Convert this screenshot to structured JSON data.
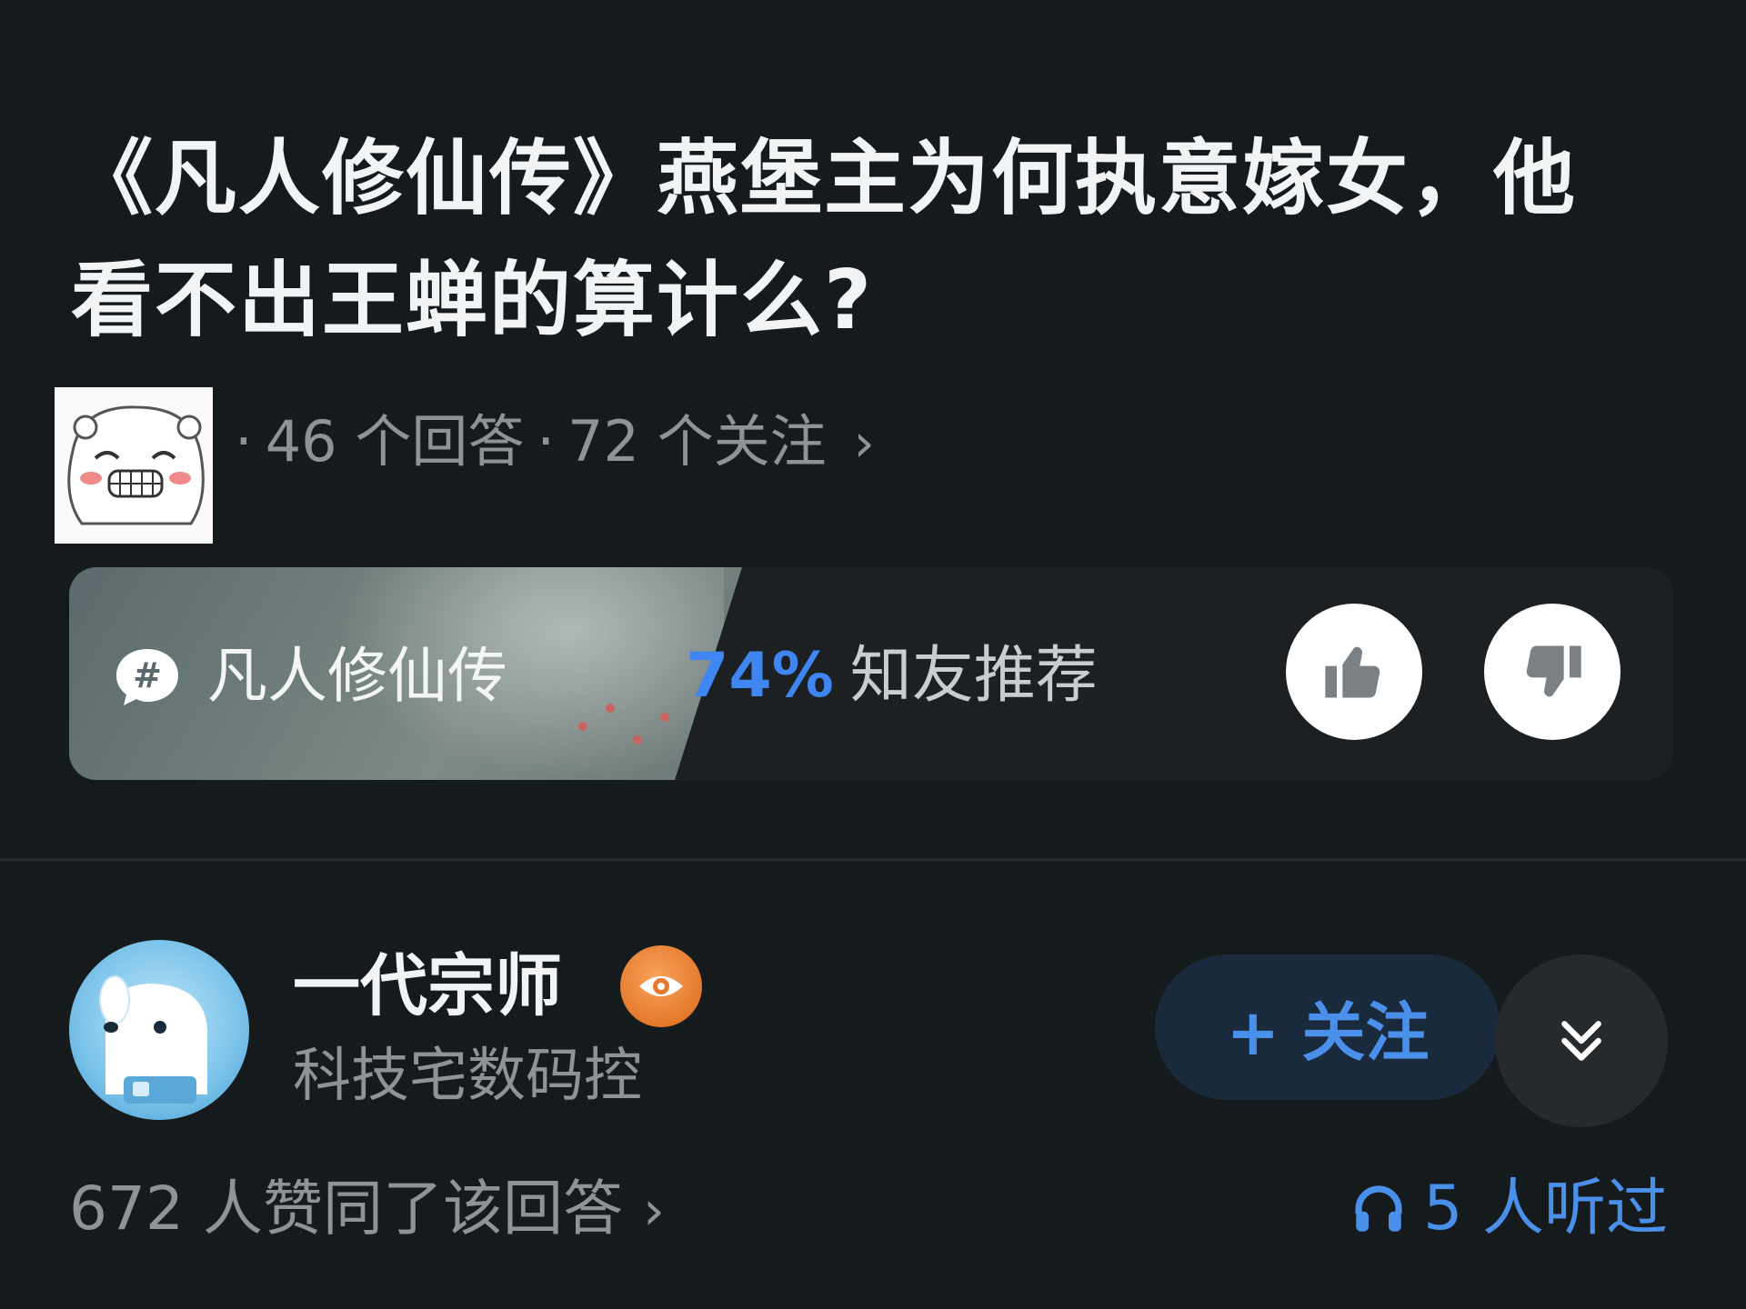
{
  "question": {
    "title": "《凡人修仙传》燕堡主为何执意嫁女，他看不出王蝉的算计么?",
    "answers_count_text": "46 个回答",
    "followers_count_text": "72 个关注",
    "separator": "·",
    "chevron": "›"
  },
  "topic": {
    "name": "凡人修仙传",
    "recommend_percent": "74%",
    "recommend_label": "知友推荐",
    "upvote_icon": "thumbs-up-icon",
    "downvote_icon": "thumbs-down-icon",
    "hash_icon": "hashtag-bubble-icon"
  },
  "author": {
    "name": "一代宗师",
    "bio": "科技宅数码控",
    "badge_icon": "eye-badge-icon",
    "follow_label": "+ 关注",
    "expand_icon": "double-chevron-down-icon"
  },
  "stats": {
    "agree_text": "672 人赞同了该回答",
    "agree_chevron": "›",
    "listen_text": "5 人听过",
    "listen_icon": "headphones-icon"
  },
  "colors": {
    "background": "#151a1c",
    "accent_blue": "#3f86f2",
    "muted_text": "#8d9398",
    "badge_orange": "#e5792c"
  }
}
